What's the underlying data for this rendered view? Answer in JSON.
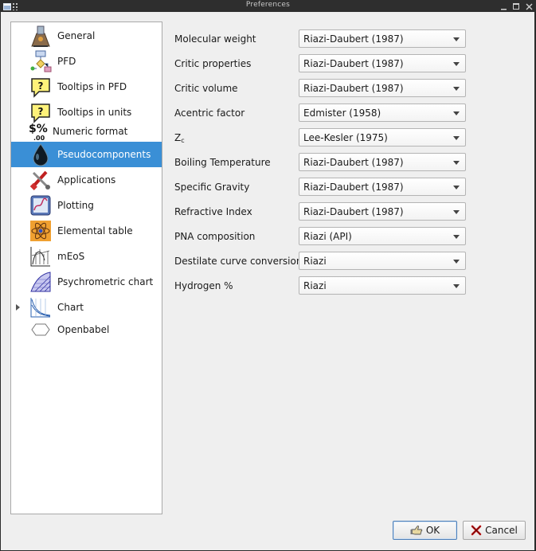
{
  "window": {
    "title": "Preferences"
  },
  "sidebar": {
    "items": [
      {
        "label": "General",
        "icon": "general-icon",
        "selected": false
      },
      {
        "label": "PFD",
        "icon": "flowchart-icon",
        "selected": false
      },
      {
        "label": "Tooltips in PFD",
        "icon": "tooltip-icon",
        "selected": false
      },
      {
        "label": "Tooltips in units",
        "icon": "tooltip-icon",
        "selected": false
      },
      {
        "label": "Numeric format",
        "icon": "numeric-format-icon",
        "selected": false
      },
      {
        "label": "Pseudocomponents",
        "icon": "oil-drop-icon",
        "selected": true
      },
      {
        "label": "Applications",
        "icon": "tools-icon",
        "selected": false
      },
      {
        "label": "Plotting",
        "icon": "plotting-icon",
        "selected": false
      },
      {
        "label": "Elemental table",
        "icon": "atom-icon",
        "selected": false
      },
      {
        "label": "mEoS",
        "icon": "meos-chart-icon",
        "selected": false
      },
      {
        "label": "Psychrometric chart",
        "icon": "psychrometric-icon",
        "selected": false
      },
      {
        "label": "Chart",
        "icon": "chart-icon",
        "selected": false,
        "expandable": true
      },
      {
        "label": "Openbabel",
        "icon": "hexagon-icon",
        "selected": false
      }
    ],
    "icon_glyphs": {
      "numeric_format": "$%",
      "numeric_format_sub": ".00",
      "tooltip": "?"
    }
  },
  "form": {
    "rows": [
      {
        "label": "Molecular weight",
        "value": "Riazi-Daubert (1987)"
      },
      {
        "label": "Critic properties",
        "value": "Riazi-Daubert (1987)"
      },
      {
        "label": "Critic volume",
        "value": "Riazi-Daubert (1987)"
      },
      {
        "label": "Acentric factor",
        "value": "Edmister (1958)"
      },
      {
        "label": "Z",
        "label_sub": "c",
        "value": "Lee-Kesler (1975)"
      },
      {
        "label": "Boiling Temperature",
        "value": "Riazi-Daubert (1987)"
      },
      {
        "label": "Specific Gravity",
        "value": "Riazi-Daubert (1987)"
      },
      {
        "label": "Refractive Index",
        "value": "Riazi-Daubert (1987)"
      },
      {
        "label": "PNA composition",
        "value": "Riazi (API)"
      },
      {
        "label": "Destilate curve conversion",
        "value": "Riazi"
      },
      {
        "label": "Hydrogen %",
        "value": "Riazi"
      }
    ]
  },
  "buttons": {
    "ok": "OK",
    "cancel": "Cancel"
  },
  "colors": {
    "selection": "#3a8fd6",
    "titlebar": "#2e2e2e",
    "background": "#efefef"
  }
}
